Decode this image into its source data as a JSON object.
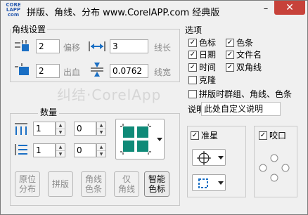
{
  "window": {
    "logo": "CORE LAPP com",
    "title": "拼版、角线、分布   www.CorelAPP.com 经典版",
    "minimize": "–",
    "close": "✕"
  },
  "corner": {
    "legend": "角线设置",
    "offset_value": "2",
    "offset_label": "偏移",
    "length_value": "3",
    "length_label": "线长",
    "bleed_value": "2",
    "bleed_label": "出血",
    "width_value": "0.0762",
    "width_label": "线宽"
  },
  "options": {
    "legend": "选项",
    "items": [
      {
        "label": "色标",
        "checked": true
      },
      {
        "label": "色条",
        "checked": true
      },
      {
        "label": "日期",
        "checked": true
      },
      {
        "label": "文件名",
        "checked": true
      },
      {
        "label": "时间",
        "checked": true
      },
      {
        "label": "双角线",
        "checked": true
      },
      {
        "label": "克隆",
        "checked": false
      }
    ],
    "group_label": "拼版时群组、角线、色条",
    "group_checked": false,
    "desc_label": "说明",
    "desc_value": "此处自定义说明"
  },
  "quantity": {
    "legend": "数量",
    "col_count": "1",
    "col_gap": "0",
    "row_count": "1",
    "row_gap": "0"
  },
  "buttons": {
    "distribute": "原位\n分布",
    "impose": "拼版",
    "corner_color": "角线\n色条",
    "only_corner": "仅\n角线",
    "smart_mark": "智能\n色标"
  },
  "registration": {
    "label": "准星",
    "checked": true
  },
  "bite": {
    "label": "咬口",
    "checked": true
  },
  "watermark": "纠结·CorelApp"
}
